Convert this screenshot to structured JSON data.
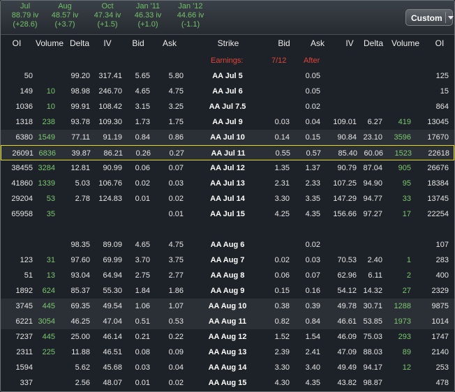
{
  "months": [
    {
      "label": "Jul",
      "iv": "88.79 iv",
      "chg": "(+28.6)"
    },
    {
      "label": "Aug",
      "iv": "48.57 iv",
      "chg": "(+3.7)"
    },
    {
      "label": "Oct",
      "iv": "47.34 iv",
      "chg": "(+1.5)"
    },
    {
      "label": "Jan '11",
      "iv": "46.33 iv",
      "chg": "(+1.0)"
    },
    {
      "label": "Jan '12",
      "iv": "44.66 iv",
      "chg": "(-1.1)"
    }
  ],
  "custom_label": "Custom",
  "headers": [
    "OI",
    "Volume",
    "Delta",
    "IV",
    "Bid",
    "Ask",
    "Strike",
    "Bid",
    "Ask",
    "IV",
    "Delta",
    "Volume",
    "OI"
  ],
  "earnings": {
    "label": "Earnings:",
    "date": "7/12",
    "timing": "After"
  },
  "rows": [
    [
      "50",
      "",
      "99.20",
      "317.41",
      "5.65",
      "5.80",
      "AA Jul 5",
      "",
      "0.05",
      "",
      "",
      "",
      "125"
    ],
    [
      "149",
      "10",
      "98.98",
      "246.70",
      "4.65",
      "4.75",
      "AA Jul 6",
      "",
      "0.05",
      "",
      "",
      "",
      "15"
    ],
    [
      "1036",
      "10",
      "99.91",
      "108.42",
      "3.15",
      "3.25",
      "AA Jul 7.5",
      "",
      "0.02",
      "",
      "",
      "",
      "864"
    ],
    [
      "1318",
      "238",
      "93.78",
      "109.30",
      "1.73",
      "1.75",
      "AA Jul 9",
      "0.03",
      "0.04",
      "109.01",
      "6.27",
      "419",
      "13045"
    ],
    [
      "6380",
      "1549",
      "77.11",
      "91.19",
      "0.84",
      "0.86",
      "AA Jul 10",
      "0.14",
      "0.15",
      "90.84",
      "23.10",
      "3596",
      "17670"
    ],
    [
      "26091",
      "6836",
      "39.87",
      "86.21",
      "0.26",
      "0.27",
      "AA Jul 11",
      "0.55",
      "0.57",
      "85.40",
      "60.06",
      "1523",
      "22618"
    ],
    [
      "38455",
      "3284",
      "12.81",
      "90.99",
      "0.06",
      "0.07",
      "AA Jul 12",
      "1.35",
      "1.37",
      "90.79",
      "87.04",
      "905",
      "26676"
    ],
    [
      "41860",
      "1339",
      "5.03",
      "106.76",
      "0.02",
      "0.03",
      "AA Jul 13",
      "2.31",
      "2.33",
      "107.25",
      "94.90",
      "95",
      "18384"
    ],
    [
      "29204",
      "53",
      "2.78",
      "124.83",
      "0.01",
      "0.02",
      "AA Jul 14",
      "3.30",
      "3.35",
      "147.29",
      "94.77",
      "33",
      "13745"
    ],
    [
      "65958",
      "35",
      "",
      "",
      "",
      "0.01",
      "AA Jul 15",
      "4.25",
      "4.35",
      "156.66",
      "97.27",
      "17",
      "22254"
    ],
    [
      "",
      "",
      "",
      "",
      "",
      "",
      "",
      "",
      "",
      "",
      "",
      "",
      ""
    ],
    [
      "",
      "",
      "98.35",
      "89.09",
      "4.65",
      "4.75",
      "AA Aug 6",
      "",
      "0.02",
      "",
      "",
      "",
      "107"
    ],
    [
      "123",
      "31",
      "97.60",
      "69.99",
      "3.70",
      "3.75",
      "AA Aug 7",
      "0.02",
      "0.03",
      "70.53",
      "2.40",
      "1",
      "283"
    ],
    [
      "51",
      "13",
      "93.04",
      "64.94",
      "2.75",
      "2.77",
      "AA Aug 8",
      "0.06",
      "0.07",
      "62.96",
      "6.11",
      "2",
      "400"
    ],
    [
      "1892",
      "624",
      "85.37",
      "55.30",
      "1.84",
      "1.86",
      "AA Aug 9",
      "0.15",
      "0.16",
      "54.12",
      "14.32",
      "27",
      "2329"
    ],
    [
      "3745",
      "445",
      "69.35",
      "49.54",
      "1.06",
      "1.07",
      "AA Aug 10",
      "0.38",
      "0.39",
      "49.78",
      "30.71",
      "1288",
      "9875"
    ],
    [
      "6221",
      "3054",
      "46.25",
      "47.04",
      "0.51",
      "0.53",
      "AA Aug 11",
      "0.82",
      "0.84",
      "46.61",
      "53.85",
      "1973",
      "1014"
    ],
    [
      "7237",
      "445",
      "25.00",
      "46.14",
      "0.21",
      "0.22",
      "AA Aug 12",
      "1.52",
      "1.54",
      "46.09",
      "75.03",
      "293",
      "1747"
    ],
    [
      "2311",
      "225",
      "11.88",
      "46.51",
      "0.08",
      "0.09",
      "AA Aug 13",
      "2.39",
      "2.41",
      "47.09",
      "88.03",
      "89",
      "2140"
    ],
    [
      "1594",
      "",
      "5.62",
      "45.68",
      "0.03",
      "0.04",
      "AA Aug 14",
      "3.30",
      "3.40",
      "49.49",
      "94.17",
      "12",
      "253"
    ],
    [
      "337",
      "",
      "2.56",
      "48.07",
      "0.01",
      "0.02",
      "AA Aug 15",
      "4.30",
      "4.35",
      "43.82",
      "98.87",
      "",
      "478"
    ]
  ],
  "highlight_row": 5,
  "alt_rows": [
    4,
    5,
    15,
    16
  ]
}
